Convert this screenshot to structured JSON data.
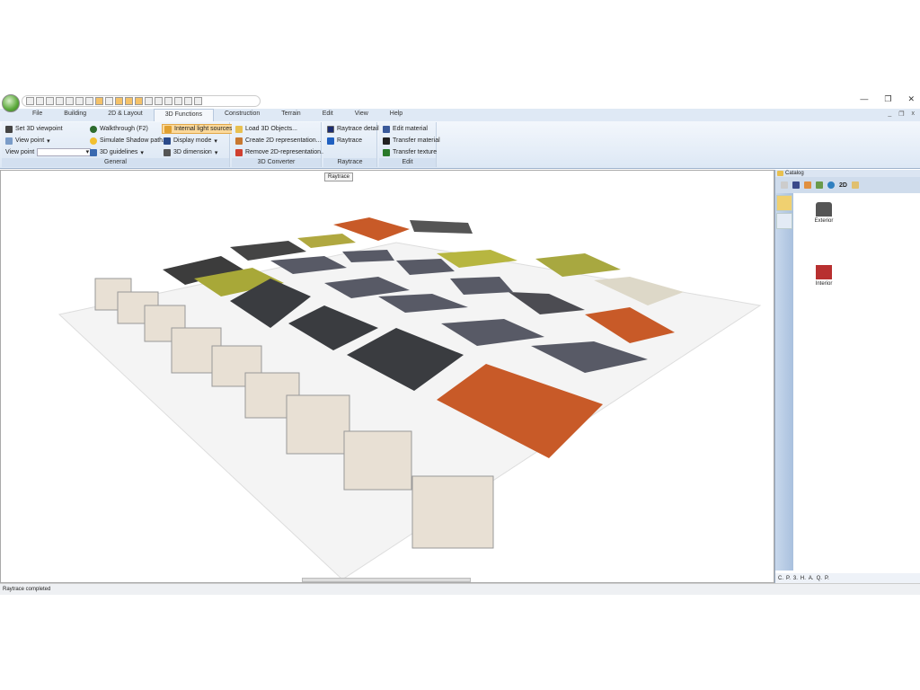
{
  "window": {
    "minimize": "—",
    "restore": "❐",
    "close": "✕",
    "mdi_min": "_",
    "mdi_restore": "❐",
    "mdi_close": "x"
  },
  "tabs": [
    "File",
    "Building",
    "2D & Layout",
    "3D Functions",
    "Construction",
    "Terrain",
    "Edit",
    "View",
    "Help"
  ],
  "active_tab": "3D Functions",
  "ribbon": {
    "general": {
      "label": "General",
      "set_viewpoint": "Set 3D viewpoint",
      "view_point_menu": "View point",
      "view_point_label": "View point",
      "view_point_value": "",
      "walkthrough": "Walkthrough (F2)",
      "shadow": "Simulate Shadow path...",
      "guidelines": "3D guidelines",
      "internal_light": "Internal light sources",
      "display_mode": "Display mode",
      "dimension": "3D dimension"
    },
    "converter": {
      "label": "3D Converter",
      "load": "Load 3D Objects...",
      "create": "Create 2D representation...",
      "remove": "Remove 2D-representation..."
    },
    "raytrace": {
      "label": "Raytrace",
      "detail": "Raytrace detail",
      "raytrace": "Raytrace"
    },
    "edit": {
      "label": "Edit",
      "edit_material": "Edit material",
      "transfer_material": "Transfer material",
      "transfer_texture": "Transfer texture"
    }
  },
  "tooltip": "Raytrace",
  "catalog": {
    "title": "Catalog",
    "items": [
      "Exterior",
      "Interior"
    ],
    "bottom_tabs": [
      "C.",
      "P.",
      "3.",
      "H.",
      "A.",
      "Q.",
      "P."
    ],
    "toolbar_2d": "2D"
  },
  "status": "Raytrace completed",
  "colors": {
    "accent": "#fbd99b",
    "ribbon": "#dde8f5"
  }
}
